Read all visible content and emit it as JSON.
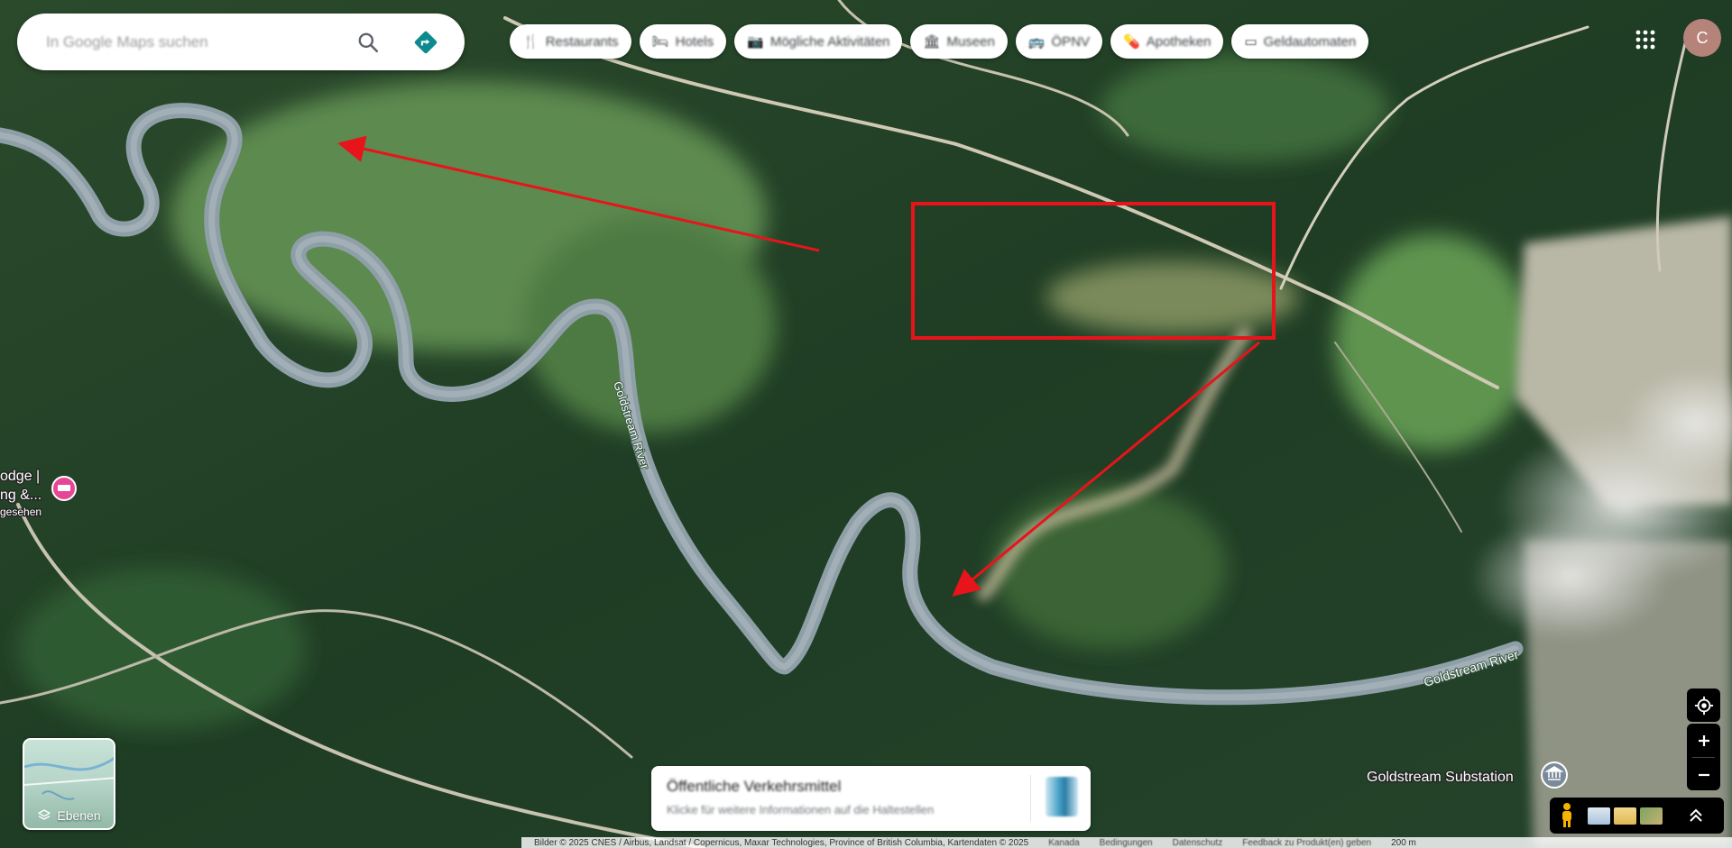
{
  "search": {
    "placeholder": "In Google Maps suchen",
    "icon": "search-icon",
    "directions_icon": "directions-icon"
  },
  "chips": [
    {
      "label": "Restaurants",
      "icon": "fork-knife-icon",
      "glyph": "🍴"
    },
    {
      "label": "Hotels",
      "icon": "bed-icon",
      "glyph": "🛏"
    },
    {
      "label": "Mögliche Aktivitäten",
      "icon": "camera-icon",
      "glyph": "📷"
    },
    {
      "label": "Museen",
      "icon": "museum-icon",
      "glyph": "🏛"
    },
    {
      "label": "ÖPNV",
      "icon": "bus-icon",
      "glyph": "🚌"
    },
    {
      "label": "Apotheken",
      "icon": "pharmacy-icon",
      "glyph": "💊"
    },
    {
      "label": "Geldautomaten",
      "icon": "atm-icon",
      "glyph": "▭"
    }
  ],
  "account": {
    "initial": "C"
  },
  "map_labels": {
    "river1": "Goldstream River",
    "river2": "Goldstream River",
    "substation": "Goldstream Substation",
    "lodge_line1": "odge |",
    "lodge_line2": "ng &...",
    "lodge_line3": "gesehen"
  },
  "layers": {
    "label": "Ebenen"
  },
  "traffic": {
    "title": "Öffentliche Verkehrsmittel",
    "subtitle": "Klicke für weitere Informationen auf die Haltestellen"
  },
  "attribution": {
    "text": "Bilder © 2025 CNES / Airbus, Landsat / Copernicus, Maxar Technologies, Province of British Columbia, Kartendaten © 2025",
    "country": "Kanada",
    "terms": "Bedingungen",
    "privacy": "Datenschutz",
    "feedback": "Feedback zu Produkt(en) geben",
    "scale": "200 m"
  },
  "colors": {
    "annotation": "#e8141b",
    "directions": "#0d8a8f",
    "hotel_pin": "#e54796"
  }
}
